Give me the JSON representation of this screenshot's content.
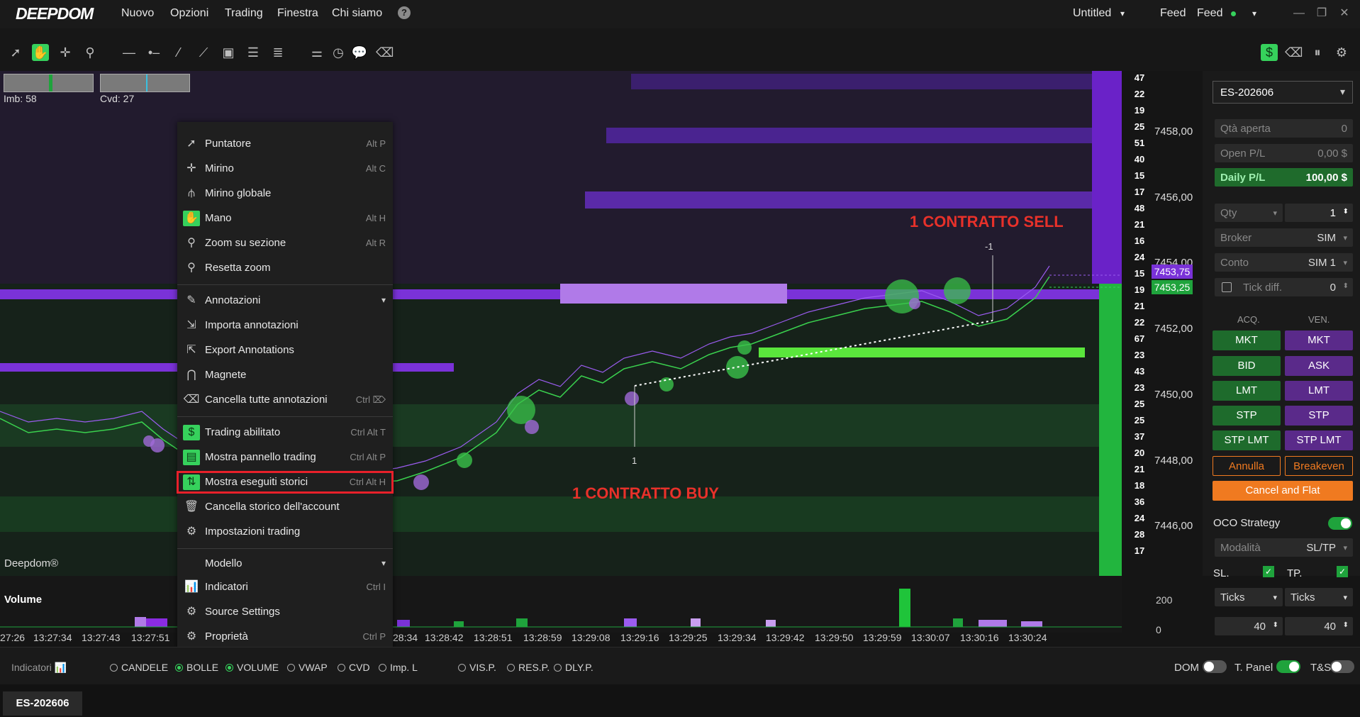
{
  "app": {
    "logo": "DEEPDOM"
  },
  "menu": {
    "items": [
      "Nuovo",
      "Opzioni",
      "Trading",
      "Finestra",
      "Chi siamo"
    ],
    "help": "?"
  },
  "topright": {
    "workspace": "Untitled",
    "feed_label": "Feed",
    "feed_status": "Feed",
    "feed_status_color": "#36d15c"
  },
  "toolbar": {
    "tools": [
      "pointer-icon",
      "hand-icon",
      "crosshair-icon",
      "zoom-icon",
      "hline-icon",
      "ray-icon",
      "trendline-icon",
      "segment-icon",
      "rectangle-icon",
      "channel-icon",
      "fib-icon",
      "settings-icon",
      "timer-icon",
      "comment-icon",
      "eraser-icon"
    ],
    "right_tools": [
      "dollar-icon",
      "eraser-icon",
      "pause-icon",
      "gear-icon"
    ]
  },
  "indicators": {
    "imb": "Imb: 58",
    "cvd": "Cvd: 27"
  },
  "chart": {
    "watermark": "Deepdom®",
    "annotation_sell": "1 CONTRATTO SELL",
    "annotation_buy": "1 CONTRATTO BUY",
    "sell_marker": "-1",
    "buy_marker": "1",
    "volume_label": "Volume",
    "volume_ticks": [
      "200",
      "0"
    ],
    "price_labels": [
      "7458,00",
      "7456,00",
      "7454,00",
      "7452,00",
      "7450,00",
      "7448,00",
      "7446,00"
    ],
    "ask_price": "7453,75",
    "bid_price": "7453,25",
    "ask_volumes": [
      "47",
      "22",
      "19",
      "25",
      "51",
      "40",
      "15",
      "17",
      "48",
      "21",
      "16",
      "24",
      "15"
    ],
    "bid_volumes": [
      "19",
      "21",
      "22",
      "67",
      "23",
      "43",
      "23",
      "25",
      "25",
      "37",
      "20",
      "21",
      "18",
      "36",
      "24",
      "28",
      "17"
    ],
    "time_labels": [
      "27:26",
      "13:27:34",
      "13:27:43",
      "13:27:51",
      "28:34",
      "13:28:42",
      "13:28:51",
      "13:28:59",
      "13:29:08",
      "13:29:16",
      "13:29:25",
      "13:29:34",
      "13:29:42",
      "13:29:50",
      "13:29:59",
      "13:30:07",
      "13:30:16",
      "13:30:24"
    ],
    "colors": {
      "ask": "#8a2be2",
      "bid": "#1fa33c",
      "sell_text": "#e8312a"
    }
  },
  "context_menu": {
    "items": [
      {
        "icon": "pointer-icon",
        "label": "Puntatore",
        "shortcut": "Alt P"
      },
      {
        "icon": "crosshair-icon",
        "label": "Mirino",
        "shortcut": "Alt C"
      },
      {
        "icon": "global-crosshair-icon",
        "label": "Mirino globale",
        "shortcut": ""
      },
      {
        "icon": "hand-icon",
        "label": "Mano",
        "shortcut": "Alt H"
      },
      {
        "icon": "zoom-section-icon",
        "label": "Zoom su sezione",
        "shortcut": "Alt R"
      },
      {
        "icon": "zoom-reset-icon",
        "label": "Resetta zoom",
        "shortcut": ""
      },
      {
        "icon": "pencil-icon",
        "label": "Annotazioni",
        "shortcut": ""
      },
      {
        "icon": "import-icon",
        "label": "Importa annotazioni",
        "shortcut": ""
      },
      {
        "icon": "export-icon",
        "label": "Export Annotations",
        "shortcut": ""
      },
      {
        "icon": "magnet-icon",
        "label": "Magnete",
        "shortcut": ""
      },
      {
        "icon": "eraser-icon",
        "label": "Cancella tutte annotazioni",
        "shortcut": "Ctrl ⌦"
      },
      {
        "icon": "dollar-icon",
        "label": "Trading abilitato",
        "shortcut": "Ctrl Alt T"
      },
      {
        "icon": "panel-icon",
        "label": "Mostra pannello trading",
        "shortcut": "Ctrl Alt P"
      },
      {
        "icon": "arrows-icon",
        "label": "Mostra eseguiti storici",
        "shortcut": "Ctrl Alt H"
      },
      {
        "icon": "trash-icon",
        "label": "Cancella storico dell'account",
        "shortcut": ""
      },
      {
        "icon": "gear-icon",
        "label": "Impostazioni trading",
        "shortcut": ""
      },
      {
        "icon": "",
        "label": "Modello",
        "shortcut": ""
      },
      {
        "icon": "bars-icon",
        "label": "Indicatori",
        "shortcut": "Ctrl I"
      },
      {
        "icon": "gear-icon",
        "label": "Source Settings",
        "shortcut": ""
      },
      {
        "icon": "gear-icon",
        "label": "Proprietà",
        "shortcut": "Ctrl P"
      }
    ]
  },
  "panel": {
    "instrument": "ES-202606",
    "qta_aperta": {
      "label": "Qtà aperta",
      "value": "0"
    },
    "open_pl": {
      "label": "Open P/L",
      "value": "0,00 $"
    },
    "daily_pl": {
      "label": "Daily P/L",
      "value": "100,00 $"
    },
    "qty": {
      "label": "Qty",
      "value": "1"
    },
    "broker": {
      "label": "Broker",
      "value": "SIM"
    },
    "conto": {
      "label": "Conto",
      "value": "SIM 1"
    },
    "tick_diff": {
      "label": "Tick diff.",
      "value": "0"
    },
    "buy_header": "ACQ.",
    "sell_header": "VEN.",
    "buy_buttons": [
      "MKT",
      "BID",
      "LMT",
      "STP",
      "STP LMT"
    ],
    "sell_buttons": [
      "MKT",
      "ASK",
      "LMT",
      "STP",
      "STP LMT"
    ],
    "annulla": "Annulla",
    "breakeven": "Breakeven",
    "cancel_flat": "Cancel and Flat",
    "oco_label": "OCO Strategy",
    "modalita": {
      "label": "Modalità",
      "value": "SL/TP"
    },
    "sl_label": "SL.",
    "tp_label": "TP.",
    "sl_mode": "Ticks",
    "tp_mode": "Ticks",
    "sl_value": "40",
    "tp_value": "40"
  },
  "bottom": {
    "indicatori": "Indicatori",
    "options": [
      {
        "label": "CANDELE",
        "on": false
      },
      {
        "label": "BOLLE",
        "on": true
      },
      {
        "label": "VOLUME",
        "on": true
      },
      {
        "label": "VWAP",
        "on": false
      },
      {
        "label": "CVD",
        "on": false
      },
      {
        "label": "Imp. L",
        "on": false
      },
      {
        "label": "VIS.P.",
        "on": false
      },
      {
        "label": "RES.P.",
        "on": false
      },
      {
        "label": "DLY.P.",
        "on": false
      }
    ],
    "dom_label": "DOM",
    "tpanel_label": "T. Panel",
    "ts_label": "T&S",
    "tab": "ES-202606"
  }
}
